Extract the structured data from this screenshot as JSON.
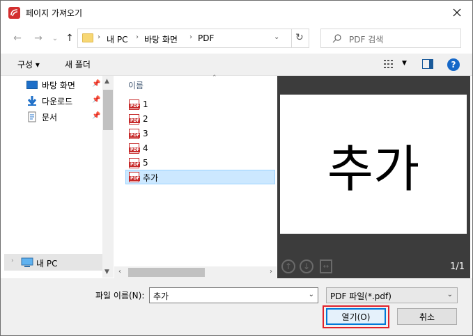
{
  "window": {
    "title": "페이지 가져오기"
  },
  "address": {
    "breadcrumbs": [
      "내 PC",
      "바탕 화면",
      "PDF"
    ]
  },
  "search": {
    "placeholder": "PDF 검색"
  },
  "toolbar": {
    "organize": "구성 ▾",
    "new_folder": "새 폴더"
  },
  "nav": {
    "items": [
      {
        "label": "바탕 화면",
        "icon": "desktop-icon",
        "pinned": true
      },
      {
        "label": "다운로드",
        "icon": "download-icon",
        "pinned": true
      },
      {
        "label": "문서",
        "icon": "document-icon",
        "pinned": true
      },
      {
        "label": "내 PC",
        "icon": "computer-icon",
        "pinned": false
      }
    ]
  },
  "files": {
    "column_name": "이름",
    "items": [
      "1",
      "2",
      "3",
      "4",
      "5",
      "추가"
    ],
    "selected": "추가"
  },
  "preview": {
    "text": "추가",
    "page_counter": "1/1"
  },
  "footer": {
    "filename_label": "파일 이름(N):",
    "filename_value": "추가",
    "filetype_value": "PDF 파일(*.pdf)",
    "open_label": "열기(O)",
    "cancel_label": "취소"
  },
  "colors": {
    "accent": "#0078d7",
    "selection": "#cce8ff",
    "focus_highlight": "#e0202a",
    "pdf_red": "#c62828"
  }
}
